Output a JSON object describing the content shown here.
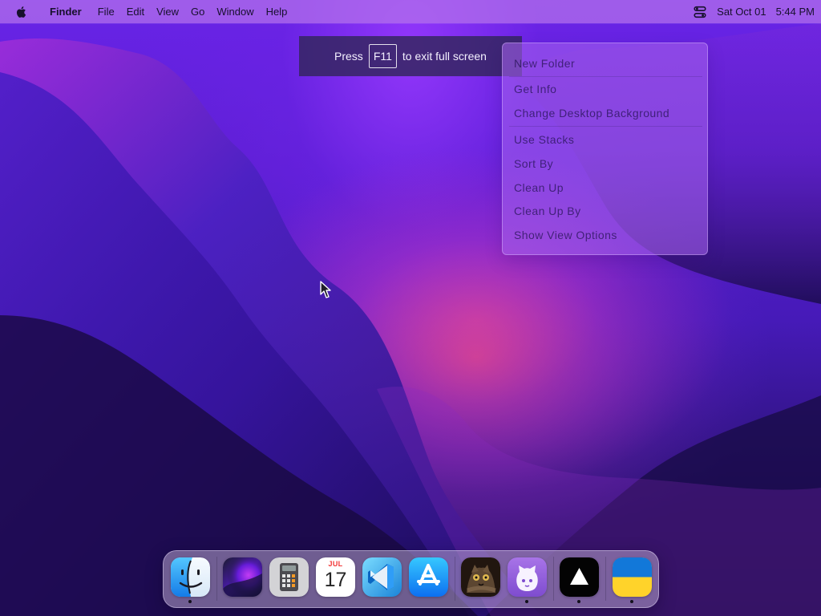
{
  "menubar": {
    "apple_icon": "apple-icon",
    "items": [
      "Finder",
      "File",
      "Edit",
      "View",
      "Go",
      "Window",
      "Help"
    ],
    "control_center_icon": "control-center-icon",
    "date": "Sat Oct 01",
    "time": "5:44 PM"
  },
  "fullscreen_banner": {
    "prefix": "Press",
    "key": "F11",
    "suffix": "to exit full screen"
  },
  "context_menu": {
    "items": [
      "New Folder",
      "Get Info",
      "Change Desktop Background",
      "Use Stacks",
      "Sort By",
      "Clean Up",
      "Clean Up By",
      "Show View Options"
    ]
  },
  "dock": {
    "items": [
      {
        "app": "finder",
        "icon": "finder-icon",
        "running": true
      },
      {
        "app": "launchpad",
        "icon": "launchpad-icon",
        "running": false
      },
      {
        "app": "calculator",
        "icon": "calculator-icon",
        "running": false
      },
      {
        "app": "calendar",
        "icon": "calendar-icon",
        "month": "JUL",
        "day": "17",
        "running": false
      },
      {
        "app": "visual-studio-code",
        "icon": "vscode-icon",
        "running": false
      },
      {
        "app": "app-store",
        "icon": "app-store-icon",
        "running": false
      },
      {
        "app": "cat-photo",
        "icon": "cat-photo-icon",
        "running": false
      },
      {
        "app": "github",
        "icon": "github-icon",
        "running": true
      },
      {
        "app": "vercel",
        "icon": "vercel-icon",
        "running": true
      },
      {
        "app": "ukraine-flag",
        "icon": "ukraine-flag-icon",
        "running": true
      }
    ]
  },
  "colors": {
    "wallpaper_top": "#6924e8",
    "wallpaper_bottom": "#160b40",
    "menu_bar": "#b472eb",
    "dock": "#b7a5ce",
    "ukraine_blue": "#1278d9",
    "ukraine_yellow": "#ffd32a"
  }
}
